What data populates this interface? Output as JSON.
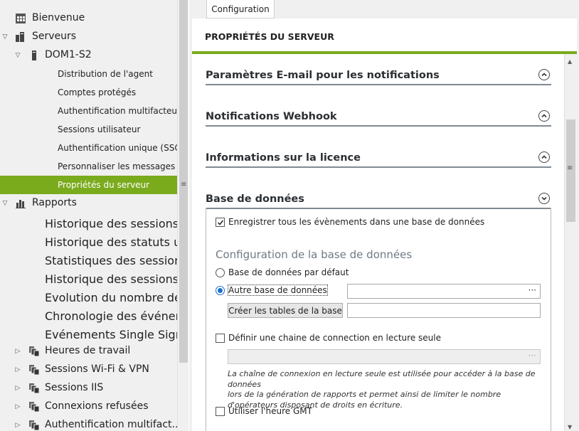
{
  "tree": {
    "items": [
      {
        "label": "Bienvenue",
        "icon": "grid-icon",
        "level": 0,
        "arrow": ""
      },
      {
        "label": "Serveurs",
        "icon": "servers-icon",
        "level": 0,
        "arrow": "expanded"
      },
      {
        "label": "DOM1-S2",
        "icon": "server-icon",
        "level": 1,
        "arrow": "expanded"
      },
      {
        "label": "Distribution de l'agent",
        "icon": "",
        "level": 2,
        "arrow": ""
      },
      {
        "label": "Comptes protégés",
        "icon": "",
        "level": 2,
        "arrow": ""
      },
      {
        "label": "Authentification multifacteur",
        "icon": "",
        "level": 2,
        "arrow": ""
      },
      {
        "label": "Sessions utilisateur",
        "icon": "",
        "level": 2,
        "arrow": ""
      },
      {
        "label": "Authentification unique (SSO)",
        "icon": "",
        "level": 2,
        "arrow": ""
      },
      {
        "label": "Personnaliser les messages",
        "icon": "",
        "level": 2,
        "arrow": ""
      },
      {
        "label": "Propriétés du serveur",
        "icon": "",
        "level": 2,
        "arrow": "",
        "selected": true
      },
      {
        "label": "Rapports",
        "icon": "bar-chart-icon",
        "level": 0,
        "arrow": "expanded"
      },
      {
        "label": "Historique des sessions",
        "icon": "",
        "level": 3,
        "arrow": ""
      },
      {
        "label": "Historique des statuts utilisateur",
        "icon": "",
        "level": 3,
        "arrow": ""
      },
      {
        "label": "Statistiques des sessions",
        "icon": "",
        "level": 3,
        "arrow": ""
      },
      {
        "label": "Historique des sessions simultan...",
        "icon": "",
        "level": 3,
        "arrow": ""
      },
      {
        "label": "Evolution du nombre de sessions",
        "icon": "",
        "level": 3,
        "arrow": ""
      },
      {
        "label": "Chronologie des événements",
        "icon": "",
        "level": 3,
        "arrow": ""
      },
      {
        "label": "Evénements Single Sign-On",
        "icon": "",
        "level": 3,
        "arrow": ""
      },
      {
        "label": "Heures de travail",
        "icon": "report-group-icon",
        "level": 1,
        "arrow": "collapsed"
      },
      {
        "label": "Sessions Wi-Fi & VPN",
        "icon": "report-group-icon",
        "level": 1,
        "arrow": "collapsed"
      },
      {
        "label": "Sessions IIS",
        "icon": "report-group-icon",
        "level": 1,
        "arrow": "collapsed"
      },
      {
        "label": "Connexions refusées",
        "icon": "report-group-icon",
        "level": 1,
        "arrow": "collapsed"
      },
      {
        "label": "Authentification multifact...",
        "icon": "report-group-icon",
        "level": 1,
        "arrow": "collapsed"
      }
    ]
  },
  "tab": {
    "label": "Configuration"
  },
  "header": {
    "title": "PROPRIÉTÉS DU SERVEUR"
  },
  "sections": {
    "email": "Paramètres E-mail pour les notifications",
    "webhook": "Notifications Webhook",
    "license": "Informations sur la licence",
    "database": "Base de données"
  },
  "database": {
    "log_all_label": "Enregistrer tous les évènements dans une base de données",
    "log_all_checked": true,
    "config_title": "Configuration de la base de données",
    "default_db_label": "Base de données par défaut",
    "other_db_label": "Autre base de données",
    "selected_option": "other",
    "other_db_value": "",
    "browse_label": "···",
    "create_tables_label": "Créer les tables de la base",
    "create_tables_value": "",
    "readonly_label": "Définir une chaine de connection en lecture seule",
    "readonly_checked": false,
    "readonly_value": "",
    "readonly_note_1": "La chaîne de connexion en lecture seule est utilisée pour accéder à la base de données",
    "readonly_note_2": "lors de la génération de rapports et permet ainsi de limiter le nombre",
    "readonly_note_3": "d'opérateurs disposant de droits en écriture.",
    "gmt_label": "Utiliser l'heure GMT",
    "gmt_checked": false
  },
  "colors": {
    "accent": "#7aab1d",
    "radio": "#1a6fd1"
  }
}
